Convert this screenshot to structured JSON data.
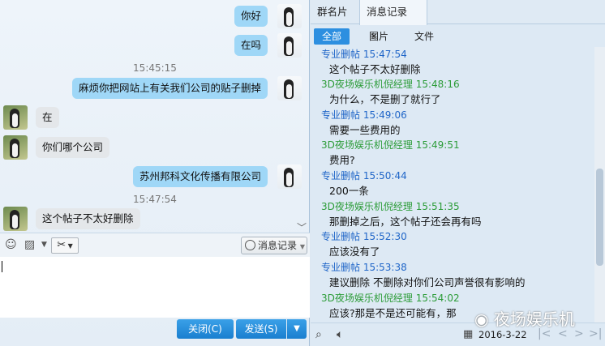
{
  "chat": {
    "messages": [
      {
        "side": "me",
        "text": "你好"
      },
      {
        "side": "me",
        "text": "在吗"
      },
      {
        "side": "time",
        "text": "15:45:15"
      },
      {
        "side": "me",
        "text": "麻烦你把网站上有关我们公司的贴子删掉"
      },
      {
        "side": "them",
        "text": "在"
      },
      {
        "side": "them",
        "text": "你们哪个公司"
      },
      {
        "side": "me",
        "text": "苏州邦科文化传播有限公司"
      },
      {
        "side": "time",
        "text": "15:47:54"
      },
      {
        "side": "them",
        "text": "这个帖子不太好删除"
      }
    ]
  },
  "toolbar": {
    "emoji_icon": "smiley-icon",
    "image_icon": "image-icon",
    "scissor_icon": "scissor-icon",
    "history_label": "消息记录"
  },
  "actions": {
    "close_label": "关闭(C)",
    "send_label": "发送(S)"
  },
  "right": {
    "tabs": [
      {
        "label": "群名片"
      },
      {
        "label": "消息记录"
      }
    ],
    "close_tab_symbol": "✕",
    "filters": [
      {
        "label": "全部"
      },
      {
        "label": "图片"
      },
      {
        "label": "文件"
      }
    ],
    "history": [
      {
        "who": "me",
        "sender": "专业删帖",
        "time": "15:47:54",
        "text": "这个帖子不太好删除"
      },
      {
        "who": "them",
        "sender": "3D夜场娱乐机倪经理",
        "time": "15:48:16",
        "text": "为什么，不是删了就行了"
      },
      {
        "who": "me",
        "sender": "专业删帖",
        "time": "15:49:06",
        "text": "需要一些费用的"
      },
      {
        "who": "them",
        "sender": "3D夜场娱乐机倪经理",
        "time": "15:49:51",
        "text": "费用?"
      },
      {
        "who": "me",
        "sender": "专业删帖",
        "time": "15:50:44",
        "text": "200一条"
      },
      {
        "who": "them",
        "sender": "3D夜场娱乐机倪经理",
        "time": "15:51:35",
        "text": "那删掉之后，这个帖子还会再有吗"
      },
      {
        "who": "me",
        "sender": "专业删帖",
        "time": "15:52:30",
        "text": "应该没有了"
      },
      {
        "who": "me",
        "sender": "专业删帖",
        "time": "15:53:38",
        "text": "建议删除    不删除对你们公司声誉很有影响的"
      },
      {
        "who": "them",
        "sender": "3D夜场娱乐机倪经理",
        "time": "15:54:02",
        "text": "应该?那是不是还可能有，那"
      }
    ],
    "date": "2016-3-22",
    "watermark": "夜场娱乐机"
  },
  "colors": {
    "accent": "#2d8fe0",
    "me_name": "#2066c8",
    "them_name": "#2c9c38",
    "me_bubble": "#9fd7f7"
  }
}
